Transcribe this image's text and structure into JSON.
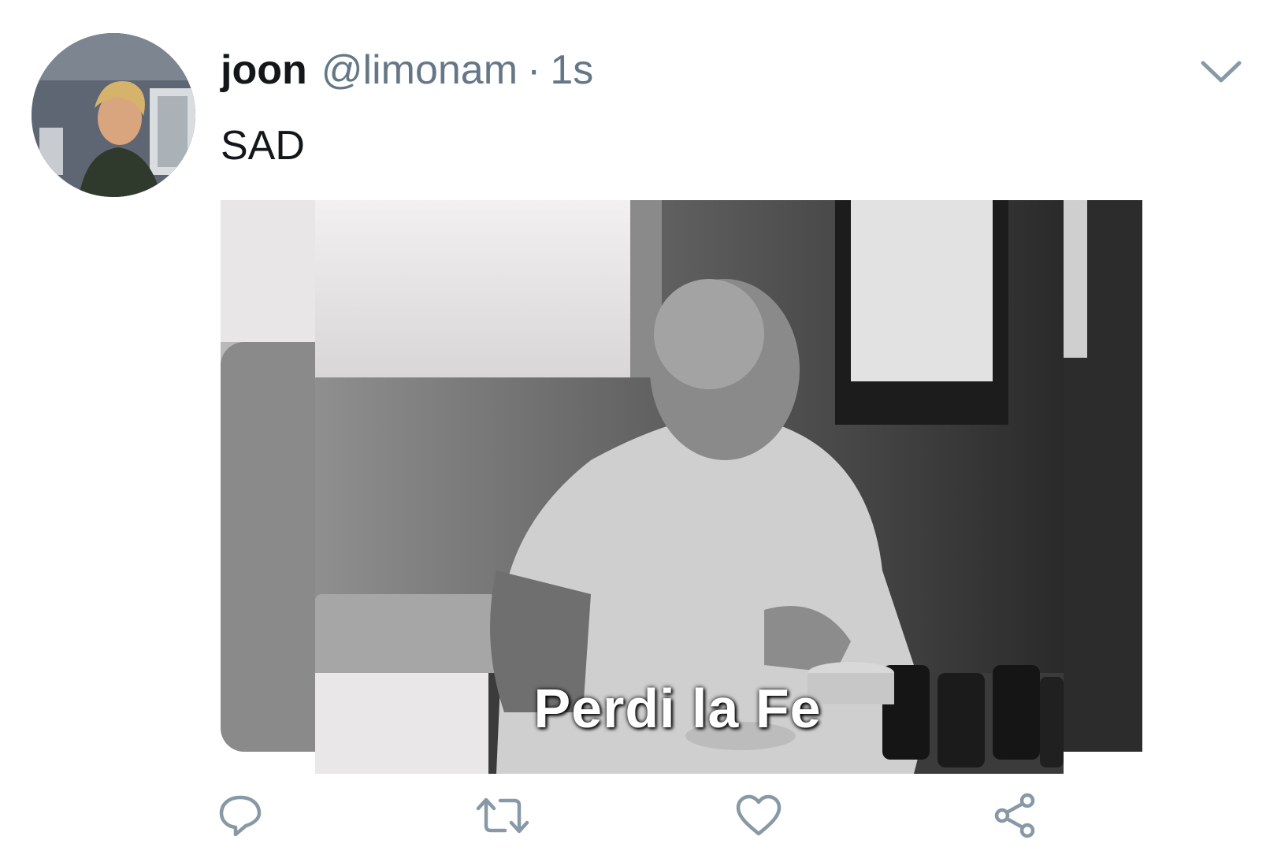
{
  "tweet": {
    "display_name": "joon",
    "handle": "@limonam",
    "separator": "·",
    "time": "1s",
    "text": "SAD",
    "media": {
      "caption": "Perdi la Fe"
    }
  },
  "icons": {
    "more": "chevron-down-icon",
    "reply": "reply-icon",
    "retweet": "retweet-icon",
    "like": "heart-icon",
    "share": "share-icon"
  },
  "colors": {
    "name": "#14171a",
    "secondary": "#657786"
  }
}
